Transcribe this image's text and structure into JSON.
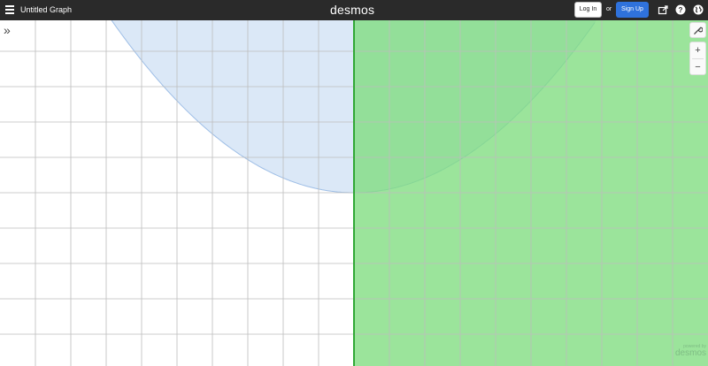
{
  "header": {
    "graph_title": "Untitled Graph",
    "brand": "desmos",
    "login_label": "Log In",
    "or_text": "or",
    "signup_label": "Sign Up",
    "icons": [
      "share-icon",
      "help-icon",
      "language-globe-icon"
    ]
  },
  "graph": {
    "expand_symbol": "»",
    "settings_symbol": "🔧",
    "zoom_in_symbol": "+",
    "zoom_out_symbol": "−",
    "watermark_top": "powered by",
    "watermark_brand": "desmos",
    "colors": {
      "grid_line": "#bdbdbd",
      "parabola_region_fill": "#cfe0f4",
      "parabola_region_stroke": "#9ebee6",
      "half_plane_fill": "#7fdc7f",
      "boundary_line": "#31a836"
    }
  }
}
